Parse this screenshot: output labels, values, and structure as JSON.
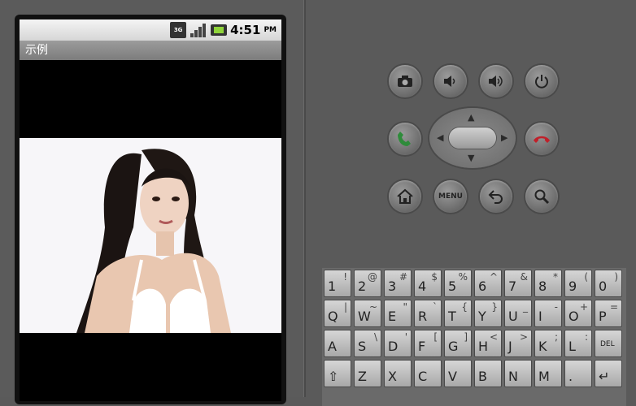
{
  "status_bar": {
    "network": "3G",
    "time": "4:51",
    "ampm": "PM"
  },
  "app": {
    "title": "示例"
  },
  "keyboard": {
    "rows": [
      [
        {
          "m": "1",
          "a": "!"
        },
        {
          "m": "2",
          "a": "@"
        },
        {
          "m": "3",
          "a": "#"
        },
        {
          "m": "4",
          "a": "$"
        },
        {
          "m": "5",
          "a": "%"
        },
        {
          "m": "6",
          "a": "^"
        },
        {
          "m": "7",
          "a": "&"
        },
        {
          "m": "8",
          "a": "*"
        },
        {
          "m": "9",
          "a": "("
        },
        {
          "m": "0",
          "a": ")"
        }
      ],
      [
        {
          "m": "Q",
          "a": "|"
        },
        {
          "m": "W",
          "a": "~"
        },
        {
          "m": "E",
          "a": "\""
        },
        {
          "m": "R",
          "a": "`"
        },
        {
          "m": "T",
          "a": "{"
        },
        {
          "m": "Y",
          "a": "}"
        },
        {
          "m": "U",
          "a": "_"
        },
        {
          "m": "I",
          "a": "-"
        },
        {
          "m": "O",
          "a": "+"
        },
        {
          "m": "P",
          "a": "="
        }
      ],
      [
        {
          "m": "A",
          "a": ""
        },
        {
          "m": "S",
          "a": "\\"
        },
        {
          "m": "D",
          "a": "'"
        },
        {
          "m": "F",
          "a": "["
        },
        {
          "m": "G",
          "a": "]"
        },
        {
          "m": "H",
          "a": "<"
        },
        {
          "m": "J",
          "a": ">"
        },
        {
          "m": "K",
          "a": ";"
        },
        {
          "m": "L",
          "a": ":"
        },
        {
          "m": "DEL",
          "a": ""
        }
      ],
      [
        {
          "m": "⇧",
          "a": ""
        },
        {
          "m": "Z",
          "a": ""
        },
        {
          "m": "X",
          "a": ""
        },
        {
          "m": "C",
          "a": ""
        },
        {
          "m": "V",
          "a": ""
        },
        {
          "m": "B",
          "a": ""
        },
        {
          "m": "N",
          "a": ""
        },
        {
          "m": "M",
          "a": ""
        },
        {
          "m": ".",
          "a": ""
        },
        {
          "m": "↵",
          "a": ""
        }
      ]
    ]
  },
  "controls": {
    "menu_label": "MENU"
  },
  "colors": {
    "call_green": "#2e8b3a",
    "end_red": "#c0202a"
  }
}
